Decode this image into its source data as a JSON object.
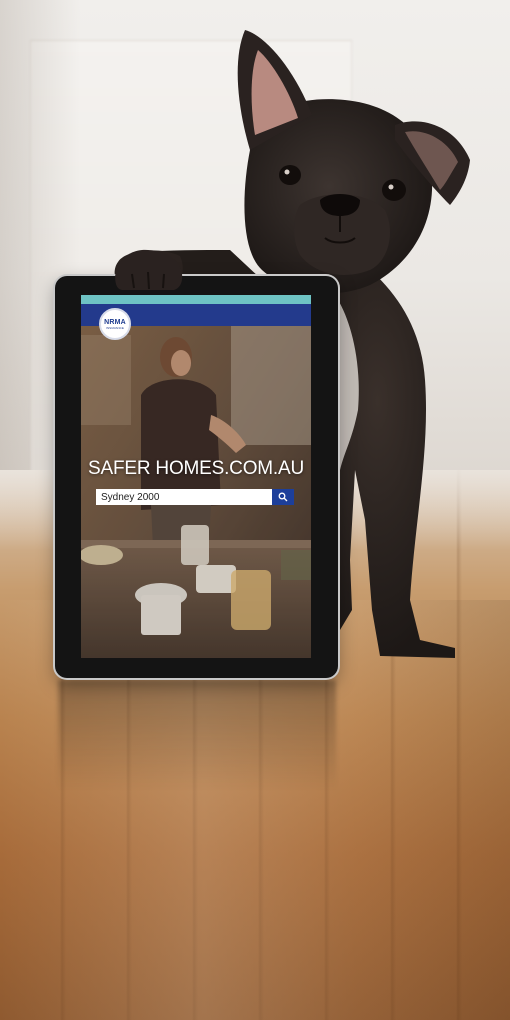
{
  "scene": {
    "subject": "french-bulldog",
    "colors": {
      "wall": "#ece9e5",
      "floor": "#b9834f",
      "dog": "#2a2421",
      "tablet_frame": "#141414",
      "accent_strip": "#6ec3c4",
      "nav_bar": "#233a8c",
      "search_button": "#1d3f9a"
    }
  },
  "tablet": {
    "logo": {
      "main_text": "NRMA",
      "sub_text": "INSURANCE",
      "icon": "nrma-logo"
    },
    "site_title": "SAFER HOMES.COM.AU",
    "search": {
      "value": "Sydney 2000",
      "icon": "search-icon"
    }
  }
}
